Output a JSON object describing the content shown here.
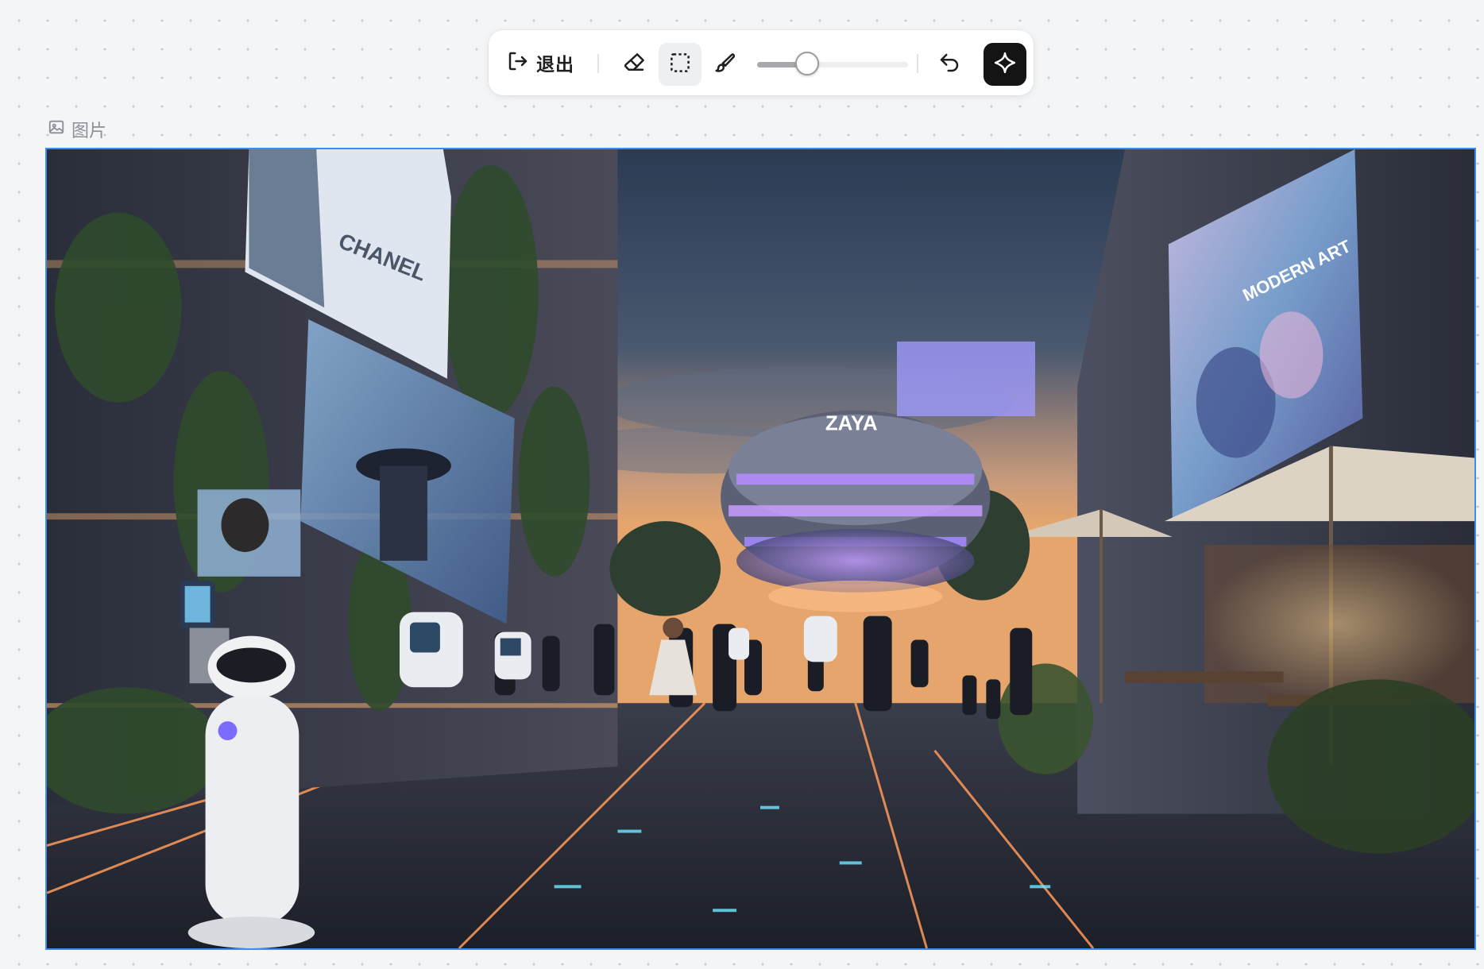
{
  "toolbar": {
    "exit_label": "退出",
    "tools": [
      {
        "name": "eraser-icon"
      },
      {
        "name": "selection-icon",
        "active": true
      },
      {
        "name": "brush-icon"
      }
    ],
    "brush_size_fraction": 0.33,
    "undo_icon": "undo-icon",
    "ai_icon": "sparkle-icon",
    "accent": "#141414"
  },
  "image_label": {
    "icon": "image-icon",
    "text": "图片"
  },
  "canvas": {
    "selection_color": "#a09bff",
    "border_color": "#3d8cf0",
    "scene_text": {
      "dome_sign": "ZAYA",
      "left_billboard": "CHANEL",
      "right_billboard": "MODERN ART"
    }
  }
}
